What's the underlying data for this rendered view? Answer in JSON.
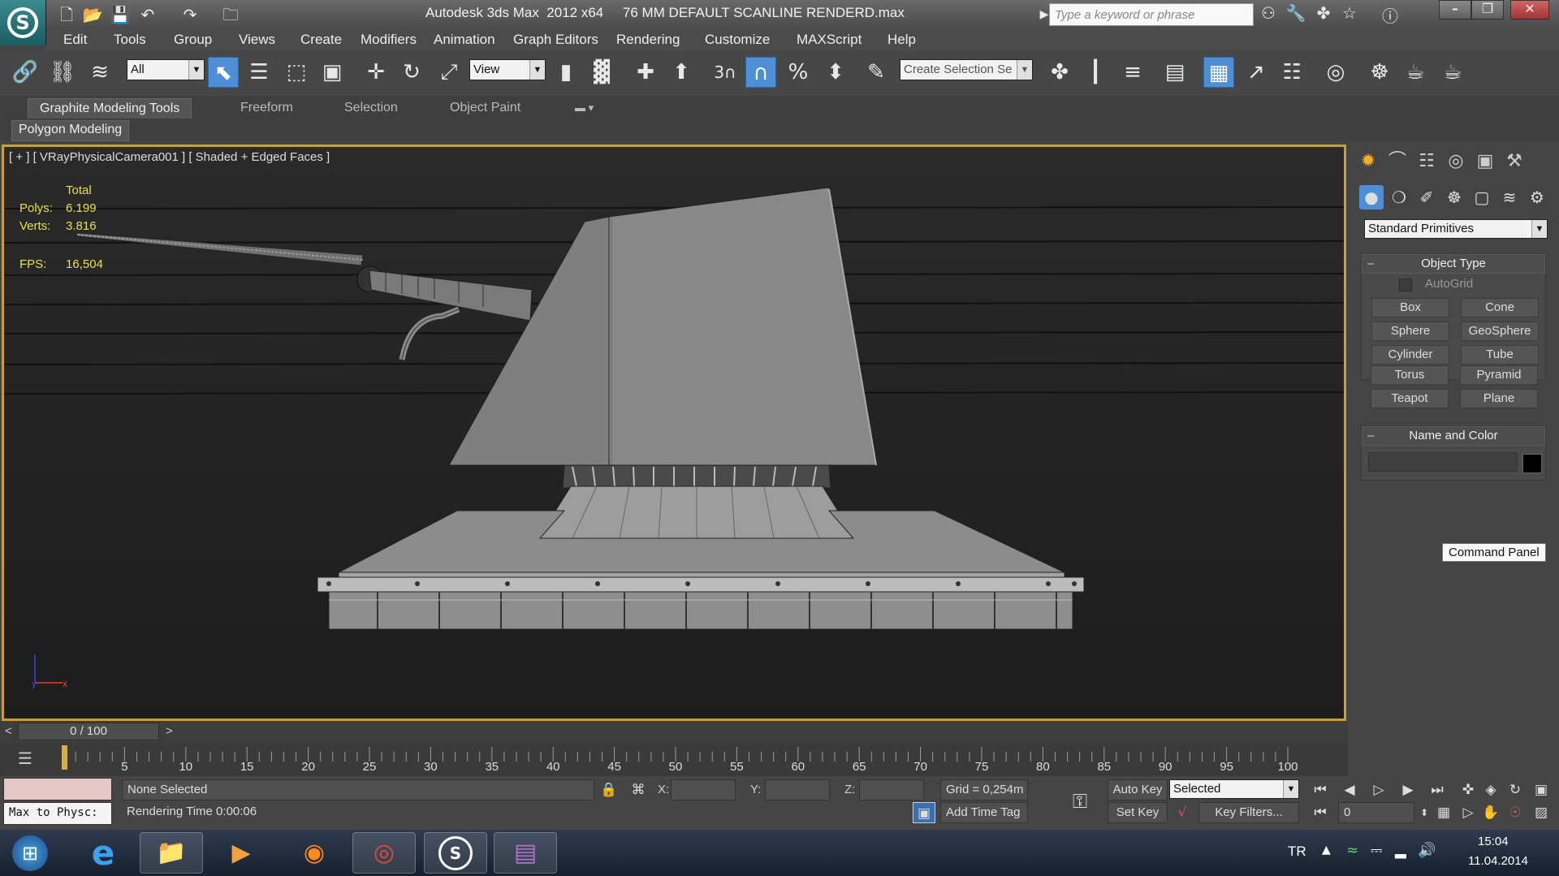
{
  "window": {
    "title": "Autodesk 3ds Max  2012 x64     76 MM DEFAULT SCANLINE RENDERD.max",
    "search_placeholder": "Type a keyword or phrase"
  },
  "menu": [
    "Edit",
    "Tools",
    "Group",
    "Views",
    "Create",
    "Modifiers",
    "Animation",
    "Graph Editors",
    "Rendering",
    "Customize",
    "MAXScript",
    "Help"
  ],
  "toolbar": {
    "selection_filter": "All",
    "reference_coord": "View",
    "snap_label": "3",
    "named_selection_placeholder": "Create Selection Se"
  },
  "ribbon": {
    "tabs": [
      "Graphite Modeling Tools",
      "Freeform",
      "Selection",
      "Object Paint"
    ],
    "active_tab": "Graphite Modeling Tools",
    "sub_tab": "Polygon Modeling"
  },
  "viewport": {
    "label": "[ + ] [ VRayPhysicalCamera001 ] [ Shaded + Edged Faces ]",
    "stats": {
      "header": "Total",
      "polys_label": "Polys:",
      "polys_value": "6.199",
      "verts_label": "Verts:",
      "verts_value": "3.816",
      "fps_label": "FPS:",
      "fps_value": "16,504"
    },
    "axis": {
      "y": "y",
      "x": "x"
    },
    "border_color": "#c6a032"
  },
  "command_panel": {
    "category": "Standard Primitives",
    "object_type_title": "Object Type",
    "autogrid_label": "AutoGrid",
    "primitives": [
      "Box",
      "Cone",
      "Sphere",
      "GeoSphere",
      "Cylinder",
      "Tube",
      "Torus",
      "Pyramid",
      "Teapot",
      "Plane"
    ],
    "name_color_title": "Name and Color",
    "object_name": "",
    "tooltip": "Command Panel"
  },
  "timeline": {
    "frame_display": "0 / 100",
    "prev": "<",
    "next": ">",
    "ticks": [
      "5",
      "10",
      "15",
      "20",
      "25",
      "30",
      "35",
      "40",
      "45",
      "50",
      "55",
      "60",
      "65",
      "70",
      "75",
      "80",
      "85",
      "90",
      "95",
      "100"
    ]
  },
  "status": {
    "maxscript_listener": "Max to Physc:",
    "selection": "None Selected",
    "prompt": "Rendering Time  0:00:06",
    "x_label": "X:",
    "y_label": "Y:",
    "z_label": "Z:",
    "x_value": "",
    "y_value": "",
    "z_value": "",
    "grid": "Grid = 0,254m",
    "add_time_tag": "Add Time Tag",
    "auto_key": "Auto Key",
    "set_key": "Set Key",
    "key_mode": "Selected",
    "key_filters": "Key Filters...",
    "current_frame": "0"
  },
  "taskbar": {
    "language": "TR",
    "time": "15:04",
    "date": "11.04.2014"
  }
}
